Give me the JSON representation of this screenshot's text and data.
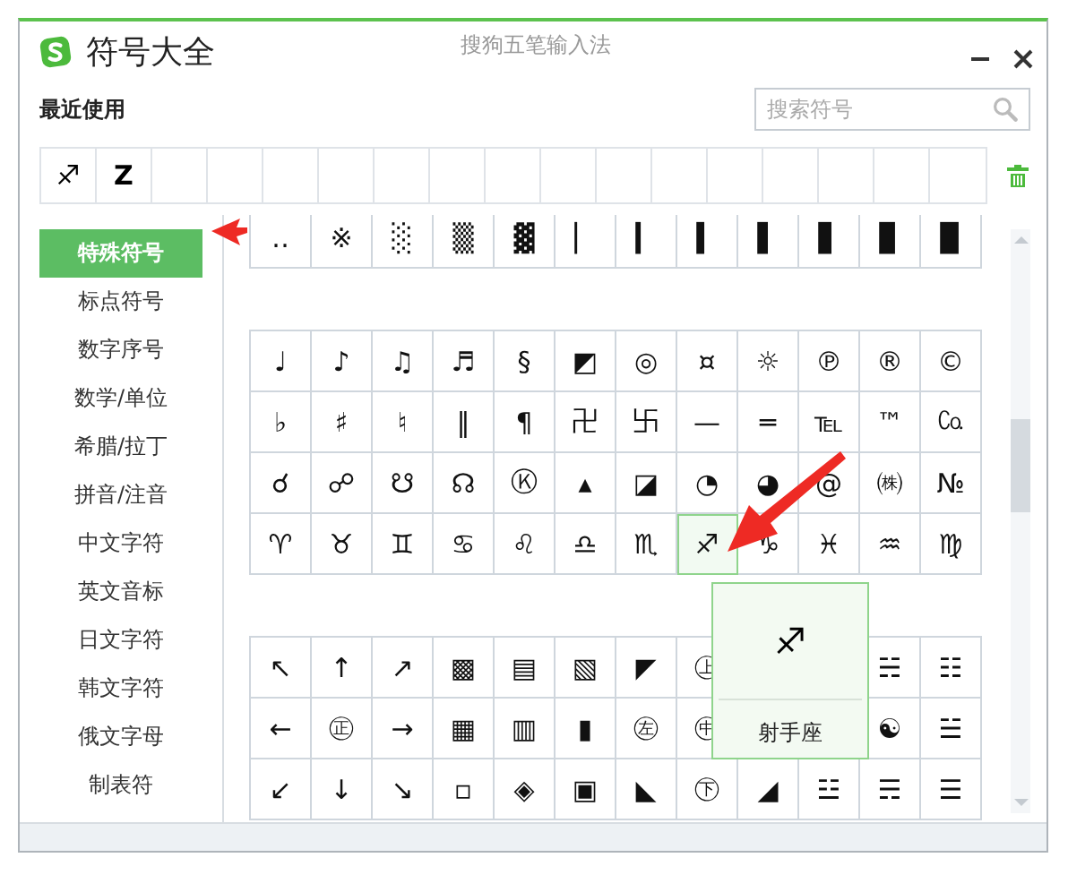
{
  "window": {
    "title": "符号大全",
    "subtitle": "搜狗五笔输入法"
  },
  "recent": {
    "label": "最近使用",
    "items": [
      "♐",
      "Z"
    ]
  },
  "search": {
    "placeholder": "搜索符号"
  },
  "sidebar": {
    "items": [
      {
        "label": "特殊符号",
        "selected": true
      },
      {
        "label": "标点符号",
        "selected": false
      },
      {
        "label": "数字序号",
        "selected": false
      },
      {
        "label": "数学/单位",
        "selected": false
      },
      {
        "label": "希腊/拉丁",
        "selected": false
      },
      {
        "label": "拼音/注音",
        "selected": false
      },
      {
        "label": "中文字符",
        "selected": false
      },
      {
        "label": "英文音标",
        "selected": false
      },
      {
        "label": "日文字符",
        "selected": false
      },
      {
        "label": "韩文字符",
        "selected": false
      },
      {
        "label": "俄文字母",
        "selected": false
      },
      {
        "label": "制表符",
        "selected": false
      }
    ]
  },
  "groups": [
    {
      "rows": [
        [
          {
            "s": "‥",
            "selected": false
          },
          {
            "s": "※",
            "selected": false
          },
          {
            "s": "░",
            "selected": false
          },
          {
            "s": "▒",
            "selected": false
          },
          {
            "s": "▓",
            "selected": false
          },
          {
            "s": "▏",
            "selected": false
          },
          {
            "s": "▎",
            "selected": false
          },
          {
            "s": "▍",
            "selected": false
          },
          {
            "s": "▌",
            "selected": false
          },
          {
            "s": "▋",
            "selected": false
          },
          {
            "s": "▊",
            "selected": false
          },
          {
            "s": "▉",
            "selected": false
          }
        ]
      ]
    },
    {
      "rows": [
        [
          {
            "s": "♩",
            "selected": false
          },
          {
            "s": "♪",
            "selected": false
          },
          {
            "s": "♫",
            "selected": false
          },
          {
            "s": "♬",
            "selected": false
          },
          {
            "s": "§",
            "selected": false
          },
          {
            "s": "◩",
            "selected": false
          },
          {
            "s": "◎",
            "selected": false
          },
          {
            "s": "¤",
            "selected": false
          },
          {
            "s": "☼",
            "selected": false
          },
          {
            "s": "℗",
            "selected": false
          },
          {
            "s": "®",
            "selected": false
          },
          {
            "s": "©",
            "selected": false
          }
        ],
        [
          {
            "s": "♭",
            "selected": false
          },
          {
            "s": "♯",
            "selected": false
          },
          {
            "s": "♮",
            "selected": false
          },
          {
            "s": "‖",
            "selected": false
          },
          {
            "s": "¶",
            "selected": false
          },
          {
            "s": "卍",
            "selected": false
          },
          {
            "s": "卐",
            "selected": false
          },
          {
            "s": "—",
            "selected": false
          },
          {
            "s": "═",
            "selected": false
          },
          {
            "s": "℡",
            "selected": false
          },
          {
            "s": "™",
            "selected": false
          },
          {
            "s": "㏇",
            "selected": false
          }
        ],
        [
          {
            "s": "☌",
            "selected": false
          },
          {
            "s": "☍",
            "selected": false
          },
          {
            "s": "☋",
            "selected": false
          },
          {
            "s": "☊",
            "selected": false
          },
          {
            "s": "Ⓚ",
            "selected": false
          },
          {
            "s": "▴",
            "selected": false
          },
          {
            "s": "◪",
            "selected": false
          },
          {
            "s": "◔",
            "selected": false
          },
          {
            "s": "◕",
            "selected": false
          },
          {
            "s": "@",
            "selected": false
          },
          {
            "s": "㈱",
            "selected": false
          },
          {
            "s": "№",
            "selected": false
          }
        ],
        [
          {
            "s": "♈",
            "selected": false
          },
          {
            "s": "♉",
            "selected": false
          },
          {
            "s": "♊",
            "selected": false
          },
          {
            "s": "♋",
            "selected": false
          },
          {
            "s": "♌",
            "selected": false
          },
          {
            "s": "♎",
            "selected": false
          },
          {
            "s": "♏",
            "selected": false
          },
          {
            "s": "♐",
            "selected": true
          },
          {
            "s": "♑",
            "selected": false
          },
          {
            "s": "♓",
            "selected": false
          },
          {
            "s": "♒",
            "selected": false
          },
          {
            "s": "♍",
            "selected": false
          }
        ]
      ]
    },
    {
      "rows": [
        [
          {
            "s": "↖",
            "selected": false
          },
          {
            "s": "↑",
            "selected": false
          },
          {
            "s": "↗",
            "selected": false
          },
          {
            "s": "▩",
            "selected": false
          },
          {
            "s": "▤",
            "selected": false
          },
          {
            "s": "▧",
            "selected": false
          },
          {
            "s": "◤",
            "selected": false
          },
          {
            "s": "㊤",
            "selected": false
          },
          null,
          null,
          {
            "s": "☵",
            "selected": false
          },
          {
            "s": "☷",
            "selected": false
          }
        ],
        [
          {
            "s": "←",
            "selected": false
          },
          {
            "s": "㊣",
            "selected": false
          },
          {
            "s": "→",
            "selected": false
          },
          {
            "s": "▦",
            "selected": false
          },
          {
            "s": "▥",
            "selected": false
          },
          {
            "s": "▮",
            "selected": false
          },
          {
            "s": "㊧",
            "selected": false
          },
          {
            "s": "㊥",
            "selected": false
          },
          null,
          null,
          {
            "s": "☯",
            "selected": false
          },
          {
            "s": "☱",
            "selected": false
          }
        ],
        [
          {
            "s": "↙",
            "selected": false
          },
          {
            "s": "↓",
            "selected": false
          },
          {
            "s": "↘",
            "selected": false
          },
          {
            "s": "▫",
            "selected": false
          },
          {
            "s": "◈",
            "selected": false
          },
          {
            "s": "▣",
            "selected": false
          },
          {
            "s": "◣",
            "selected": false
          },
          {
            "s": "㊦",
            "selected": false
          },
          {
            "s": "◢",
            "selected": false
          },
          {
            "s": "☳",
            "selected": false
          },
          {
            "s": "☴",
            "selected": false
          },
          {
            "s": "☰",
            "selected": false
          }
        ]
      ]
    }
  ],
  "preview": {
    "symbol": "♐",
    "name": "射手座"
  }
}
